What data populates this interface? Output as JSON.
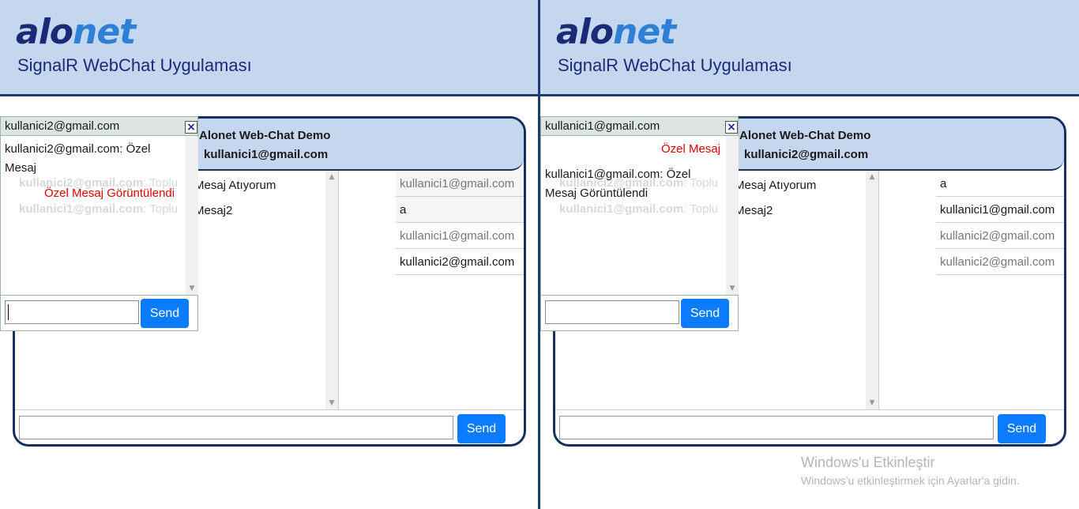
{
  "colors": {
    "header_bg": "#c5d7ee",
    "navy": "#1b2a78",
    "accent_blue": "#0b7bff",
    "logo_light": "#2e7fd6",
    "private_red": "#e00000"
  },
  "brand": {
    "logo_dark": "alo",
    "logo_light": "net",
    "app_title": "SignalR WebChat Uygulaması"
  },
  "left_window": {
    "chat_title": "Alonet Web-Chat Demo",
    "current_user": "kullanici1@gmail.com",
    "messages": [
      "Mesaj Atıyorum",
      "Mesaj2"
    ],
    "users": [
      "kullanici1@gmail.com",
      "a",
      "kullanici1@gmail.com",
      "kullanici2@gmail.com"
    ],
    "send_label": "Send",
    "popup": {
      "user": "kullanici2@gmail.com",
      "close_symbol": "×",
      "messages": [
        "kullanici2@gmail.com: Özel",
        "Mesaj"
      ],
      "notice": "Özel Mesaj Görüntülendi",
      "faded": [
        {
          "user": "kullanici2@gmail.com",
          "text": ": Toplu"
        },
        {
          "user": "kullanici1@gmail.com",
          "text": ": Toplu"
        }
      ],
      "send_label": "Send"
    }
  },
  "right_window": {
    "chat_title": "Alonet Web-Chat Demo",
    "current_user": "kullanici2@gmail.com",
    "messages": [
      "Mesaj Atıyorum",
      "Mesaj2"
    ],
    "users": [
      "a",
      "kullanici1@gmail.com",
      "kullanici2@gmail.com",
      "kullanici2@gmail.com"
    ],
    "send_label": "Send",
    "popup": {
      "user": "kullanici1@gmail.com",
      "close_symbol": "×",
      "sent": "Özel Mesaj",
      "messages": [
        "kullanici1@gmail.com: Özel",
        "Mesaj Görüntülendi"
      ],
      "faded": [
        {
          "user": "kullanici2@gmail.com",
          "text": ": Toplu"
        },
        {
          "user": "kullanici1@gmail.com",
          "text": ": Toplu"
        }
      ],
      "send_label": "Send"
    }
  },
  "watermark": {
    "line1": "Windows'u Etkinleştir",
    "line2": "Windows'u etkinleştirmek için Ayarlar'a gidin."
  }
}
